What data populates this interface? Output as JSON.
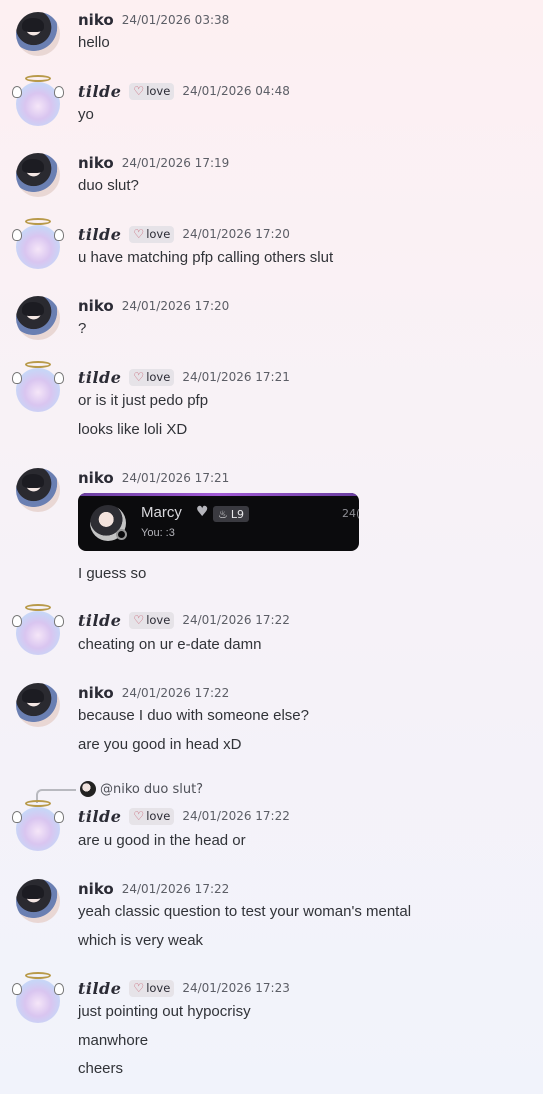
{
  "messages": [
    {
      "author": "niko",
      "time": "24/01/2026 03:38",
      "lines": [
        "hello"
      ]
    },
    {
      "author": "tilde",
      "tag": "love",
      "time": "24/01/2026 04:48",
      "lines": [
        "yo"
      ]
    },
    {
      "author": "niko",
      "time": "24/01/2026 17:19",
      "lines": [
        "duo slut?"
      ]
    },
    {
      "author": "tilde",
      "tag": "love",
      "time": "24/01/2026 17:20",
      "lines": [
        "u have matching pfp calling others slut"
      ]
    },
    {
      "author": "niko",
      "time": "24/01/2026 17:20",
      "lines": [
        "?"
      ]
    },
    {
      "author": "tilde",
      "tag": "love",
      "time": "24/01/2026 17:21",
      "lines": [
        "or is it just pedo pfp",
        "looks like loli XD"
      ]
    },
    {
      "author": "niko",
      "time": "24/01/2026 17:21",
      "lines": [
        "I guess so"
      ],
      "embed": {
        "name": "Marcy",
        "level": "L9",
        "subtitle": "You: :3",
        "cut": "24("
      }
    },
    {
      "author": "tilde",
      "tag": "love",
      "time": "24/01/2026 17:22",
      "lines": [
        "cheating on ur e-date damn"
      ]
    },
    {
      "author": "niko",
      "time": "24/01/2026 17:22",
      "lines": [
        "because I duo with someone else?",
        "are you good in head xD"
      ]
    },
    {
      "author": "tilde",
      "tag": "love",
      "time": "24/01/2026 17:22",
      "lines": [
        "are u good in the head or"
      ],
      "reply": {
        "user": "@niko",
        "text": "duo slut?"
      }
    },
    {
      "author": "niko",
      "time": "24/01/2026 17:22",
      "lines": [
        "yeah classic question to test your woman's mental",
        "which is very weak"
      ]
    },
    {
      "author": "tilde",
      "tag": "love",
      "time": "24/01/2026 17:23",
      "lines": [
        "just pointing out hypocrisy",
        "manwhore",
        "cheers"
      ]
    }
  ]
}
